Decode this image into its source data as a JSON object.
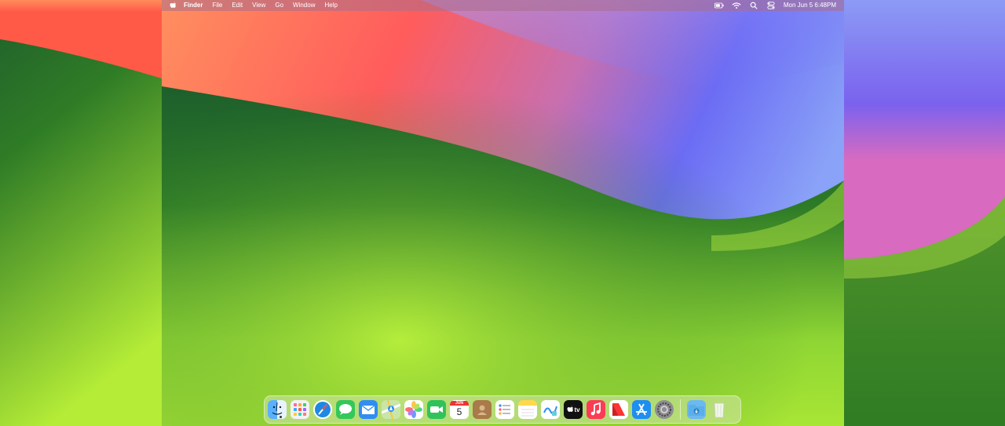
{
  "menubar": {
    "app_name": "Finder",
    "menus": [
      "File",
      "Edit",
      "View",
      "Go",
      "Window",
      "Help"
    ],
    "clock": "Mon Jun 5  6:48PM"
  },
  "dock": {
    "apps": [
      {
        "name": "Finder",
        "icon": "finder-icon",
        "color": "#3b8ff0"
      },
      {
        "name": "Launchpad",
        "icon": "launchpad-icon",
        "color": "#f2f2f2"
      },
      {
        "name": "Safari",
        "icon": "safari-icon",
        "color": "#1e88e5"
      },
      {
        "name": "Messages",
        "icon": "messages-icon",
        "color": "#34c759"
      },
      {
        "name": "Mail",
        "icon": "mail-icon",
        "color": "#2f8df3"
      },
      {
        "name": "Maps",
        "icon": "maps-icon",
        "color": "#8fd17a"
      },
      {
        "name": "Photos",
        "icon": "photos-icon",
        "color": "#ffffff"
      },
      {
        "name": "FaceTime",
        "icon": "facetime-icon",
        "color": "#32c25a"
      },
      {
        "name": "Calendar",
        "icon": "calendar-icon",
        "color": "#ffffff"
      },
      {
        "name": "Contacts",
        "icon": "contacts-icon",
        "color": "#a97a4a"
      },
      {
        "name": "Reminders",
        "icon": "reminders-icon",
        "color": "#ffffff"
      },
      {
        "name": "Notes",
        "icon": "notes-icon",
        "color": "#ffd84d"
      },
      {
        "name": "Freeform",
        "icon": "freeform-icon",
        "color": "#ffffff"
      },
      {
        "name": "TV",
        "icon": "tv-icon",
        "color": "#111111"
      },
      {
        "name": "Music",
        "icon": "music-icon",
        "color": "#fc3c55"
      },
      {
        "name": "News",
        "icon": "news-icon",
        "color": "#ffffff"
      },
      {
        "name": "App Store",
        "icon": "app-store-icon",
        "color": "#1f8ef1"
      },
      {
        "name": "System Settings",
        "icon": "settings-icon",
        "color": "#8e8e93"
      }
    ],
    "calendar_month": "JUN",
    "calendar_day": "5",
    "tv_label": "tv",
    "downloads_icon": "downloads-folder-icon",
    "trash_icon": "trash-icon"
  }
}
